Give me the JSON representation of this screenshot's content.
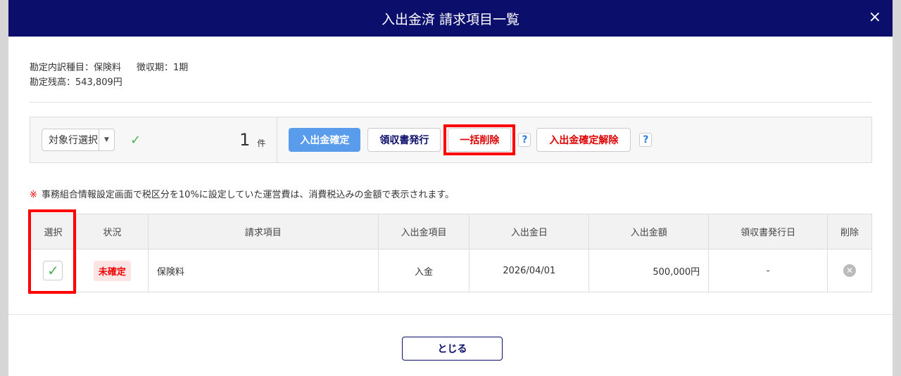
{
  "header": {
    "title": "入出金済 請求項目一覧",
    "close": "×"
  },
  "info": {
    "item_type": "勘定内訳種目：保険料",
    "period": "徴収期：1期",
    "balance": "勘定残高：543,809円"
  },
  "toolbar": {
    "select": "対象行選択",
    "count": "1",
    "count_unit": "件",
    "confirm": "入出金確定",
    "receipt": "領収書発行",
    "bulk_delete": "一括削除",
    "help": "?",
    "unconfirm": "入出金確定解除"
  },
  "note": {
    "mark": "※",
    "text": "事務組合情報設定画面で税区分を10%に設定していた運営費は、消費税込みの金額で表示されます。"
  },
  "table": {
    "headers": [
      "選択",
      "状況",
      "請求項目",
      "入出金項目",
      "入出金日",
      "入出金額",
      "領収書発行日",
      "削除"
    ],
    "rows": [
      {
        "status": "未確定",
        "item": "保険料",
        "type": "入金",
        "date": "2026/04/01",
        "amount": "500,000円",
        "receipt_date": "-"
      }
    ]
  },
  "footer": {
    "close": "とじる"
  }
}
